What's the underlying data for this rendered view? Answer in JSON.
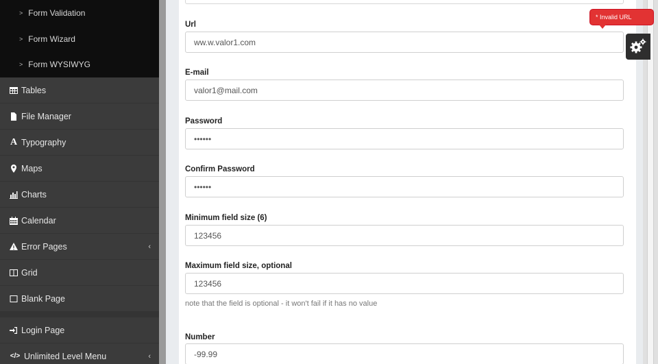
{
  "sidebar": {
    "submenu": [
      {
        "label": "Form Validation"
      },
      {
        "label": "Form Wizard"
      },
      {
        "label": "Form WYSIWYG"
      }
    ],
    "items": [
      {
        "label": "Tables",
        "icon": "table-icon"
      },
      {
        "label": "File Manager",
        "icon": "file-icon"
      },
      {
        "label": "Typography",
        "icon": "font-icon"
      },
      {
        "label": "Maps",
        "icon": "map-marker-icon"
      },
      {
        "label": "Charts",
        "icon": "bar-chart-icon"
      },
      {
        "label": "Calendar",
        "icon": "calendar-icon"
      },
      {
        "label": "Error Pages",
        "icon": "warning-icon",
        "arrow": "‹"
      },
      {
        "label": "Grid",
        "icon": "columns-icon"
      },
      {
        "label": "Blank Page",
        "icon": "square-icon"
      }
    ],
    "bottom_items": [
      {
        "label": "Login Page",
        "icon": "sign-in-icon"
      },
      {
        "label": "Unlimited Level Menu",
        "icon": "code-icon",
        "arrow": "‹"
      }
    ]
  },
  "form": {
    "url": {
      "label": "Url",
      "value": "ww.w.valor1.com"
    },
    "email": {
      "label": "E-mail",
      "value": "valor1@mail.com"
    },
    "password": {
      "label": "Password",
      "value": "••••••"
    },
    "confirm_password": {
      "label": "Confirm Password",
      "value": "••••••"
    },
    "min_size": {
      "label": "Minimum field size (6)",
      "value": "123456"
    },
    "max_size": {
      "label": "Maximum field size, optional",
      "value": "123456",
      "note": "note that the field is optional - it won't fail if it has no value"
    },
    "number": {
      "label": "Number",
      "value": "-99.99"
    }
  },
  "tooltip": {
    "text": "* Invalid URL"
  },
  "colors": {
    "error": "#e23333",
    "sidebar": "#3b3b3b",
    "submenu": "#0e0e0e"
  }
}
